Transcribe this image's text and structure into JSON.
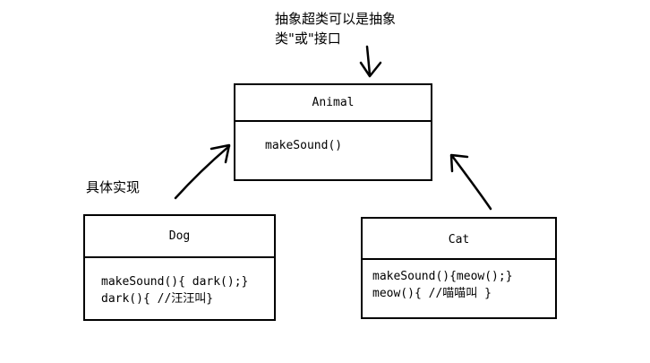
{
  "notes": {
    "superclass_line1": "抽象超类可以是抽象",
    "superclass_line2": "类\"或\"接口",
    "concrete": "具体实现"
  },
  "classes": {
    "animal": {
      "name": "Animal",
      "members": [
        "makeSound()"
      ]
    },
    "dog": {
      "name": "Dog",
      "members": [
        "makeSound(){ dark();}",
        "dark(){ //汪汪叫}"
      ]
    },
    "cat": {
      "name": "Cat",
      "members": [
        "makeSound(){meow();}",
        "meow(){ //喵喵叫 }"
      ]
    }
  }
}
